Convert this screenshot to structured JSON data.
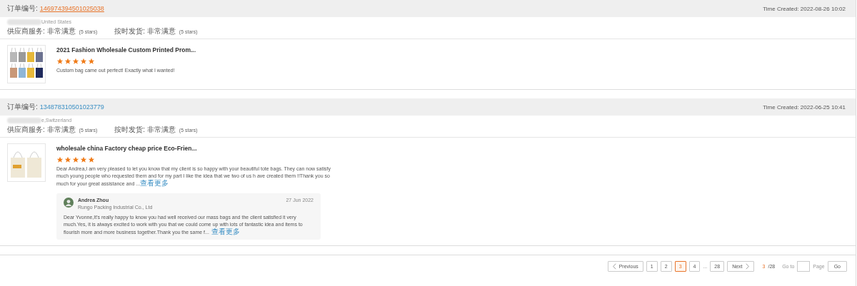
{
  "orders": [
    {
      "order_label": "订单编号:",
      "order_number": "146974394501025038",
      "visited": true,
      "time_created": "Time Created: 2022-08-26 10:02",
      "location": "United States",
      "ratings": [
        {
          "label": "供应商服务: 非常满意",
          "stars_text": "(5 stars)"
        },
        {
          "label": "按时发货: 非常满意",
          "stars_text": "(5 stars)"
        }
      ],
      "product": {
        "title": "2021 Fashion Wholesale Custom Printed Prom...",
        "stars": 5,
        "review": "Custom bag came out perfect! Exactly what I wanted!"
      }
    },
    {
      "order_label": "订单编号:",
      "order_number": "134878310501023779",
      "visited": false,
      "time_created": "Time Created: 2022-06-25 10:41",
      "location": "e,Switzerland",
      "ratings": [
        {
          "label": "供应商服务: 非常满意",
          "stars_text": "(5 stars)"
        },
        {
          "label": "按时发货: 非常满意",
          "stars_text": "(5 stars)"
        }
      ],
      "product": {
        "title": "wholesale china Factory cheap price Eco-Frien...",
        "stars": 5,
        "review": "Dear Andrea,I am very pleased to let you know that my client is so happy with your beautiful tote bags. They can now satisfy much young people who requested them and for my part I like the idea that we two of us h ave created them !!Thank you so much for your great assistance and ...",
        "more": "查看更多"
      },
      "reply": {
        "name": "Andrea Zhou",
        "company": "Rungo Packing Industrial Co., Ltd",
        "date": "27 Jun 2022",
        "text": "Dear Yvonne,It's really happy to know you had well received our mass bags and the client satisfied it very much.Yes, it is always excited to work with you that we could come up with lots of fantastic idea and items to flourish more and more business  together.Thank you the same f...",
        "more": "查看更多"
      }
    }
  ],
  "pagination": {
    "previous": "Previous",
    "pages": [
      {
        "label": "1",
        "selected": false
      },
      {
        "label": "2",
        "selected": false
      },
      {
        "label": "3",
        "selected": true
      },
      {
        "label": "4",
        "selected": false
      }
    ],
    "ellipsis": "...",
    "last": {
      "label": "28",
      "selected": false
    },
    "next": "Next",
    "current": "3",
    "total": "/28",
    "goto_label": "Go to",
    "page_label": "Page",
    "go": "Go"
  }
}
